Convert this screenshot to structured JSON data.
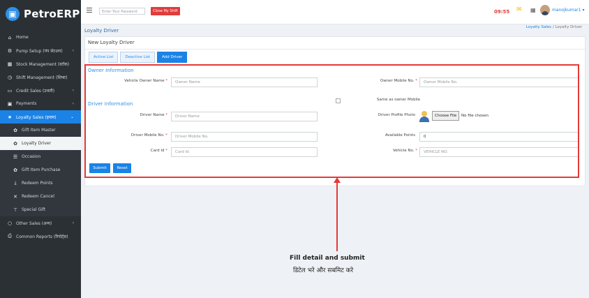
{
  "brand": {
    "name": "PetroERP"
  },
  "sidebar": {
    "items": [
      {
        "label": "Home",
        "icon": "home-icon",
        "glyph": "⌂",
        "chevron": ""
      },
      {
        "label": "Pump Setup (पंप सेटअप)",
        "icon": "gears-icon",
        "glyph": "⚙",
        "chevron": "‹"
      },
      {
        "label": "Stock Management (स्टॉक)",
        "icon": "cubes-icon",
        "glyph": "▦",
        "chevron": ""
      },
      {
        "label": "Shift Management (शिफ्ट)",
        "icon": "clock-icon",
        "glyph": "◷",
        "chevron": ""
      },
      {
        "label": "Credit Sales (उधारी)",
        "icon": "card-icon",
        "glyph": "▭",
        "chevron": "‹"
      },
      {
        "label": "Payments",
        "icon": "money-icon",
        "glyph": "▣",
        "chevron": "‹"
      },
      {
        "label": "Loyalty Sales (इनाम)",
        "icon": "trophy-icon",
        "glyph": "★",
        "chevron": "⌄"
      },
      {
        "label": "Gift Item Master",
        "icon": "gift-icon",
        "glyph": "✿",
        "chevron": ""
      },
      {
        "label": "Loyalty Driver",
        "icon": "gift-icon",
        "glyph": "✿",
        "chevron": ""
      },
      {
        "label": "Occasion",
        "icon": "list-icon",
        "glyph": "☰",
        "chevron": ""
      },
      {
        "label": "Gift Item Purchase",
        "icon": "gift-icon",
        "glyph": "✿",
        "chevron": ""
      },
      {
        "label": "Redeem Points",
        "icon": "download-icon",
        "glyph": "⤓",
        "chevron": ""
      },
      {
        "label": "Redeem Cancel",
        "icon": "cross-icon",
        "glyph": "✕",
        "chevron": ""
      },
      {
        "label": "Special Gift",
        "icon": "filter-icon",
        "glyph": "⊤",
        "chevron": ""
      },
      {
        "label": "Other Sales (अन्य)",
        "icon": "circle-icon",
        "glyph": "○",
        "chevron": "‹"
      },
      {
        "label": "Common Reports (रिपोर्ट्स)",
        "icon": "print-icon",
        "glyph": "⎙",
        "chevron": ""
      }
    ]
  },
  "topbar": {
    "password_placeholder": "Enter Your Password",
    "close_shift_label": "Close My Shift",
    "timer": "09:55",
    "username": "manojkumar1 ▾"
  },
  "page": {
    "title": "Loyalty Driver",
    "breadcrumb": {
      "parent": "Loyalty Sales",
      "separator": "/",
      "current": "Loyalty Driver"
    }
  },
  "card": {
    "title": "New Loyalty Driver",
    "tabs": [
      "Active List",
      "Deactive List",
      "Add Driver"
    ]
  },
  "form": {
    "owner_section": "Owner Information",
    "driver_section": "Driver Information",
    "vehicle_owner_name": {
      "label": "Vehicle Owner Name",
      "required": "*",
      "placeholder": "Owner Name"
    },
    "owner_mobile": {
      "label": "Owner Mobile No.",
      "required": "*",
      "placeholder": "Owner Mobile No."
    },
    "same_as_owner": {
      "label": "Same as owner Mobile"
    },
    "driver_name": {
      "label": "Driver Name",
      "required": "*",
      "placeholder": "Driver Name"
    },
    "driver_photo": {
      "label": "Driver Profile Photo",
      "button": "Choose File",
      "status": "No file chosen"
    },
    "driver_mobile": {
      "label": "Driver Mobile No.",
      "required": "*",
      "placeholder": "Driver Mobile No."
    },
    "available_points": {
      "label": "Available Points",
      "value": "0"
    },
    "card_id": {
      "label": "Card Id",
      "required": "*",
      "placeholder": "Card Id"
    },
    "vehicle_no": {
      "label": "Vehicle No.",
      "required": "*",
      "placeholder": "VEHICLE NO."
    },
    "submit_label": "Submit",
    "reset_label": "Reset"
  },
  "annotation": {
    "english": "Fill detail and submit",
    "hindi": "डिटेल भरे और सबमिट करे"
  },
  "colors": {
    "accent": "#1b82e6",
    "sidebar_bg": "#2b3035",
    "highlight": "#e53935"
  }
}
